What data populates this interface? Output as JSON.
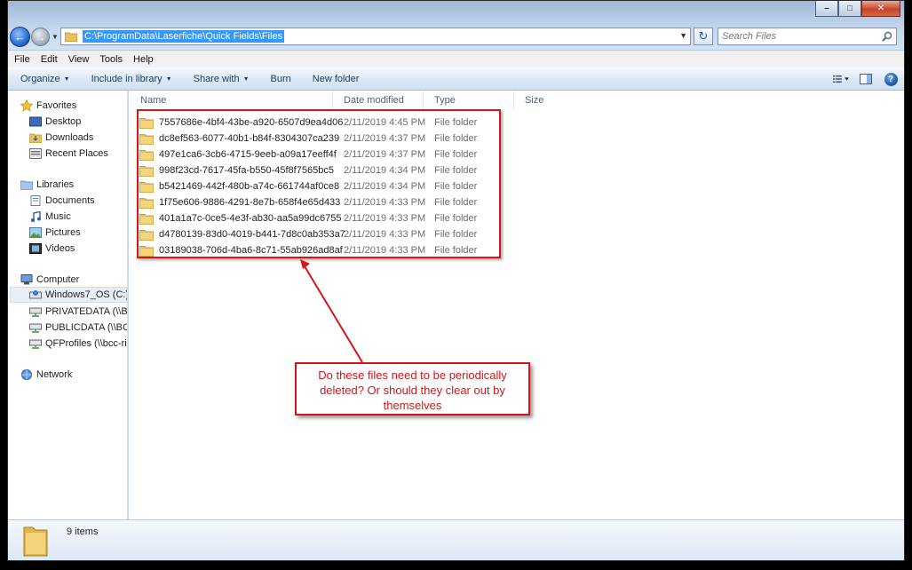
{
  "window": {
    "controls": {
      "minimize": "–",
      "maximize": "□",
      "close": "✕"
    }
  },
  "address": {
    "path": "C:\\ProgramData\\Laserfiche\\Quick Fields\\Files",
    "search_placeholder": "Search Files"
  },
  "menu": [
    "File",
    "Edit",
    "View",
    "Tools",
    "Help"
  ],
  "commands": [
    {
      "label": "Organize",
      "dropdown": true
    },
    {
      "label": "Include in library",
      "dropdown": true
    },
    {
      "label": "Share with",
      "dropdown": true
    },
    {
      "label": "Burn",
      "dropdown": false
    },
    {
      "label": "New folder",
      "dropdown": false
    }
  ],
  "nav": {
    "favorites": {
      "label": "Favorites",
      "items": [
        "Desktop",
        "Downloads",
        "Recent Places"
      ]
    },
    "libraries": {
      "label": "Libraries",
      "items": [
        "Documents",
        "Music",
        "Pictures",
        "Videos"
      ]
    },
    "computer": {
      "label": "Computer",
      "items": [
        "Windows7_OS (C:)",
        "PRIVATEDATA (\\\\BC",
        "PUBLICDATA (\\\\BCC",
        "QFProfiles (\\\\bcc-ric"
      ]
    },
    "network": {
      "label": "Network"
    }
  },
  "columns": [
    "Name",
    "Date modified",
    "Type",
    "Size"
  ],
  "files": [
    {
      "name": "7557686e-4bf4-43be-a920-6507d9ea4d06",
      "date": "2/11/2019 4:45 PM",
      "type": "File folder"
    },
    {
      "name": "dc8ef563-6077-40b1-b84f-8304307ca239",
      "date": "2/11/2019 4:37 PM",
      "type": "File folder"
    },
    {
      "name": "497e1ca6-3cb6-4715-9eeb-a09a17eeff4f",
      "date": "2/11/2019 4:37 PM",
      "type": "File folder"
    },
    {
      "name": "998f23cd-7617-45fa-b550-45f8f7565bc5",
      "date": "2/11/2019 4:34 PM",
      "type": "File folder"
    },
    {
      "name": "b5421469-442f-480b-a74c-661744af0ce8",
      "date": "2/11/2019 4:34 PM",
      "type": "File folder"
    },
    {
      "name": "1f75e606-9886-4291-8e7b-658f4e65d433",
      "date": "2/11/2019 4:33 PM",
      "type": "File folder"
    },
    {
      "name": "401a1a7c-0ce5-4e3f-ab30-aa5a99dc6755",
      "date": "2/11/2019 4:33 PM",
      "type": "File folder"
    },
    {
      "name": "d4780139-83d0-4019-b441-7d8c0ab353a7",
      "date": "2/11/2019 4:33 PM",
      "type": "File folder"
    },
    {
      "name": "03189038-706d-4ba6-8c71-55ab926ad8af",
      "date": "2/11/2019 4:33 PM",
      "type": "File folder"
    }
  ],
  "annotation": {
    "text": "Do these files need to be periodically deleted? Or should they clear out by themselves",
    "color": "#d4161a"
  },
  "details": {
    "count": "9 items"
  },
  "icons": {
    "back": "←",
    "forward": "→",
    "refresh": "↻",
    "help": "?",
    "caret": "▼"
  }
}
